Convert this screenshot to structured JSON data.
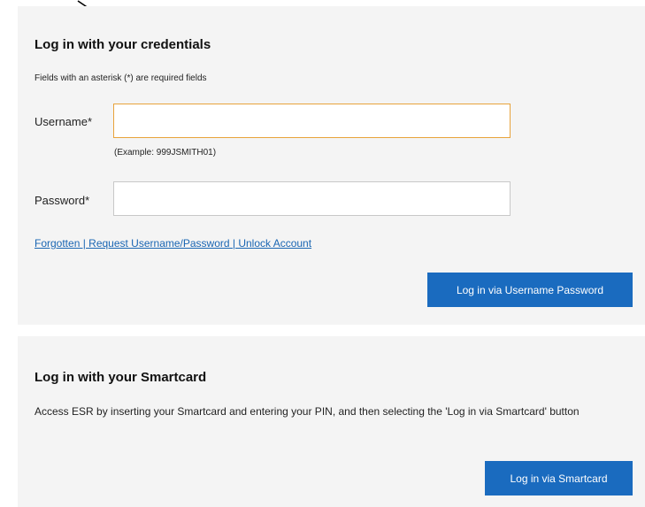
{
  "credentials": {
    "heading": "Log in with your credentials",
    "hint": "Fields with an asterisk (*) are required fields",
    "username_label": "Username*",
    "username_value": "",
    "username_example": "(Example: 999JSMITH01)",
    "password_label": "Password*",
    "password_value": "",
    "links_text": "Forgotten | Request Username/Password | Unlock Account",
    "login_button": "Log in via Username Password"
  },
  "smartcard": {
    "heading": "Log in with your Smartcard",
    "description": "Access ESR by inserting your Smartcard and entering your PIN, and then selecting the 'Log in via Smartcard' button",
    "login_button": "Log in via Smartcard"
  },
  "colors": {
    "panel_bg": "#f4f4f4",
    "button_bg": "#1a6bbf",
    "link": "#1a66b3",
    "focus_border": "#e8a33b"
  },
  "icons": {
    "annotation": "arrow-down-right-icon"
  }
}
